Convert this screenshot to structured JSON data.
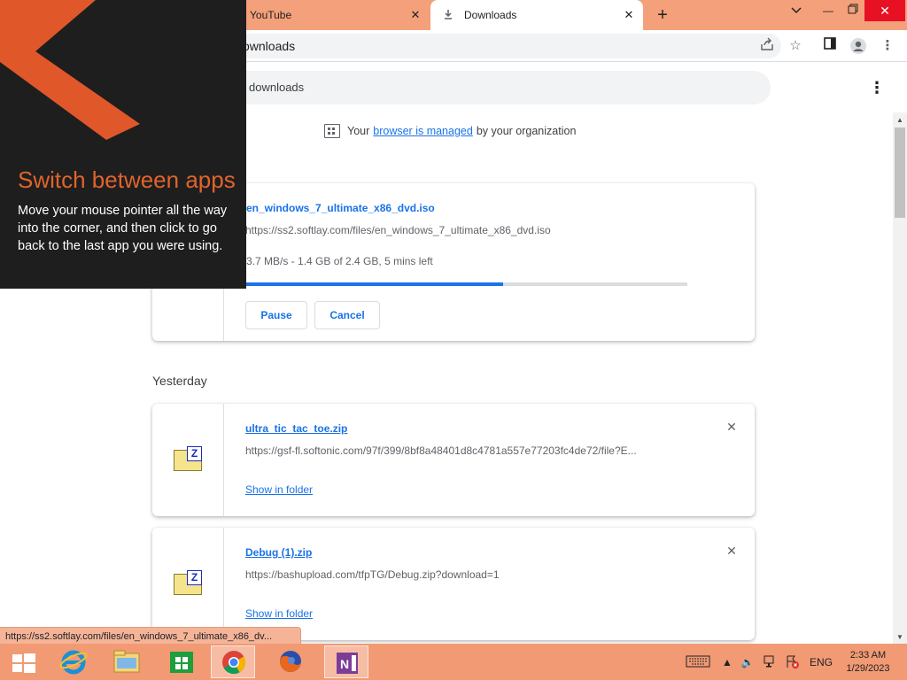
{
  "browser": {
    "tabs": [
      {
        "title": "YouTube",
        "active": false
      },
      {
        "title": "Downloads",
        "active": true
      }
    ],
    "new_tab_symbol": "+",
    "address_text": "ownloads",
    "status_url": "https://ss2.softlay.com/files/en_windows_7_ultimate_x86_dv..."
  },
  "downloads_page": {
    "search_text": "downloads",
    "managed_prefix": "Your",
    "managed_link": "browser is managed",
    "managed_suffix": "by your organization",
    "active_download": {
      "name": "en_windows_7_ultimate_x86_dvd.iso",
      "url": "https://ss2.softlay.com/files/en_windows_7_ultimate_x86_dvd.iso",
      "status": "3.7 MB/s - 1.4 GB of 2.4 GB, 5 mins left",
      "progress": 0.5833,
      "pause_label": "Pause",
      "cancel_label": "Cancel"
    },
    "section_date": "Yesterday",
    "past_downloads": [
      {
        "name": "ultra_tic_tac_toe.zip",
        "url": "https://gsf-fl.softonic.com/97f/399/8bf8a48401d8c4781a557e77203fc4de72/file?E...",
        "show_label": "Show in folder"
      },
      {
        "name": "Debug (1).zip",
        "url": "https://bashupload.com/tfpTG/Debug.zip?download=1",
        "show_label": "Show in folder"
      }
    ]
  },
  "charm_tip": {
    "title": "Switch between apps",
    "body": "Move your mouse pointer all the way into the corner, and then click to go back to the last app you were using."
  },
  "taskbar": {
    "apps": [
      "start-icon",
      "internet-explorer-icon",
      "file-explorer-icon",
      "store-icon",
      "chrome-icon",
      "firefox-icon",
      "onenote-icon"
    ],
    "language": "ENG",
    "time": "2:33 AM",
    "date": "1/29/2023"
  },
  "colors": {
    "accent": "#f19a74",
    "link": "#1a73e8",
    "charm_title": "#e0642c"
  }
}
